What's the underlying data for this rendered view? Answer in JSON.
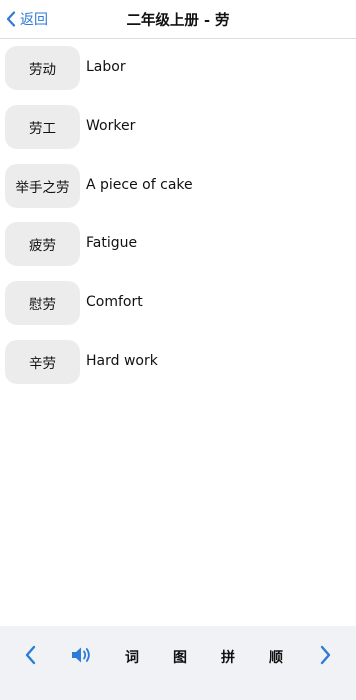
{
  "header": {
    "back_label": "返回",
    "title": "二年级上册 - 劳"
  },
  "words": [
    {
      "word": "劳动",
      "meaning": "Labor"
    },
    {
      "word": "劳工",
      "meaning": "Worker"
    },
    {
      "word": "举手之劳",
      "meaning": "A piece of cake"
    },
    {
      "word": "疲劳",
      "meaning": "Fatigue"
    },
    {
      "word": "慰劳",
      "meaning": "Comfort"
    },
    {
      "word": "辛劳",
      "meaning": "Hard work"
    }
  ],
  "toolbar": {
    "prev_icon": "chevron-left-icon",
    "audio_icon": "speaker-icon",
    "ci_label": "词",
    "tu_label": "图",
    "pin_label": "拼",
    "shun_label": "顺",
    "next_icon": "chevron-right-icon"
  },
  "colors": {
    "accent": "#2e7bd6",
    "chip_bg": "#ececec",
    "toolbar_bg": "#f0f2f5"
  }
}
